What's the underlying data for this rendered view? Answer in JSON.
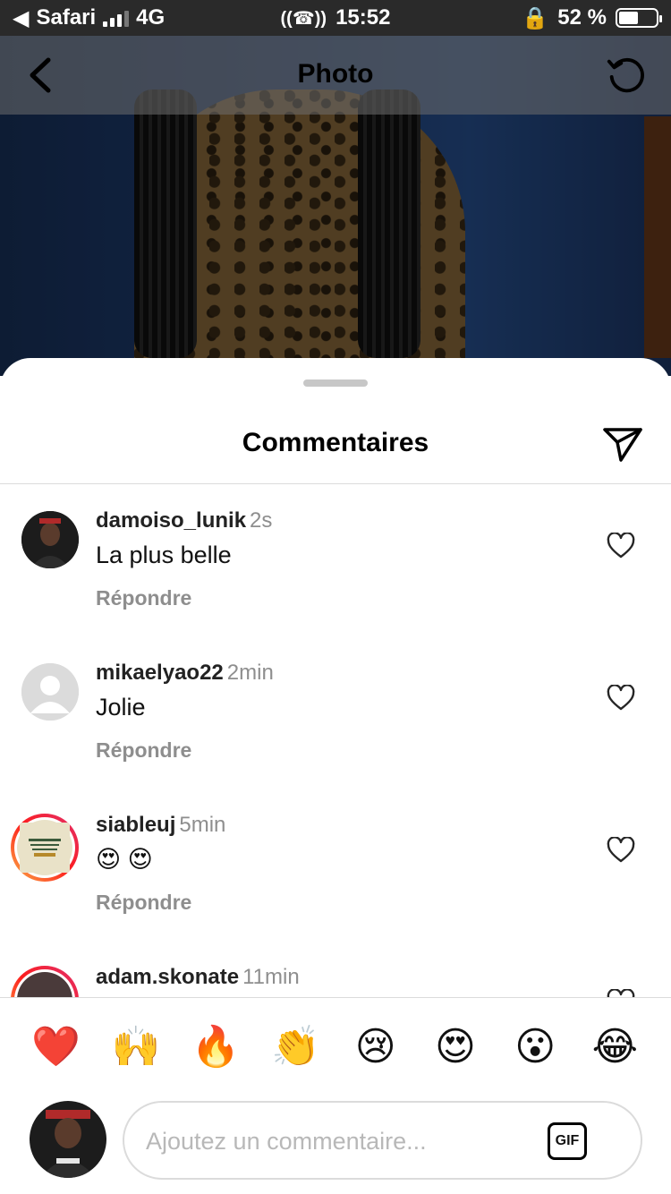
{
  "status_bar": {
    "back_app": "Safari",
    "network": "4G",
    "time": "15:52",
    "battery": "52 %",
    "battery_level": 0.52
  },
  "header": {
    "title": "Photo",
    "back_icon": "chevron-left-icon",
    "refresh_icon": "refresh-icon"
  },
  "sheet": {
    "title": "Commentaires",
    "send_icon": "send-icon"
  },
  "comments": [
    {
      "username": "damoiso_lunik",
      "time": "2s",
      "text": "La plus belle",
      "reply": "Répondre"
    },
    {
      "username": "mikaelyao22",
      "time": "2min",
      "text": "Jolie",
      "reply": "Répondre"
    },
    {
      "username": "siableuj",
      "time": "5min",
      "text": "😍 😍",
      "reply": "Répondre"
    },
    {
      "username": "adam.skonate",
      "time": "11min",
      "text": "",
      "reply": ""
    }
  ],
  "emoji_bar": [
    "❤️",
    "🙌",
    "🔥",
    "👏",
    "😢",
    "😍",
    "😮",
    "😂"
  ],
  "composer": {
    "placeholder": "Ajoutez un commentaire...",
    "gif_label": "GIF"
  },
  "colors": {
    "story_ring_start": "#fcb045",
    "story_ring_end": "#e1306c",
    "muted_text": "#8e8e8e",
    "divider": "#dbdbdb"
  }
}
